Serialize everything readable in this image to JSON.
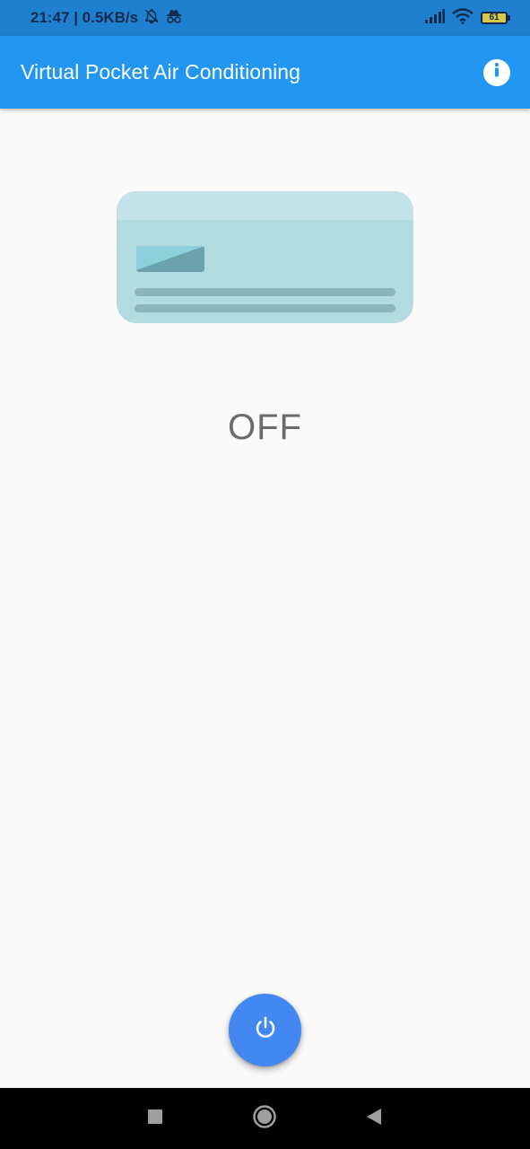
{
  "status_bar": {
    "time_speed": "21:47 | 0.5KB/s",
    "battery_level": "61",
    "icons": [
      "notifications-muted-icon",
      "incognito-icon",
      "signal-icon",
      "wifi-icon",
      "battery-icon"
    ]
  },
  "app_bar": {
    "title": "Virtual Pocket Air Conditioning",
    "info_icon": "info-icon",
    "background": "#2196f3"
  },
  "main": {
    "ac_status": "OFF",
    "ac_icon": "air-conditioner-icon"
  },
  "fab": {
    "icon": "power-icon",
    "color": "#4387f1"
  },
  "nav_bar": {
    "buttons": [
      "recents-button",
      "home-button",
      "back-button"
    ]
  }
}
